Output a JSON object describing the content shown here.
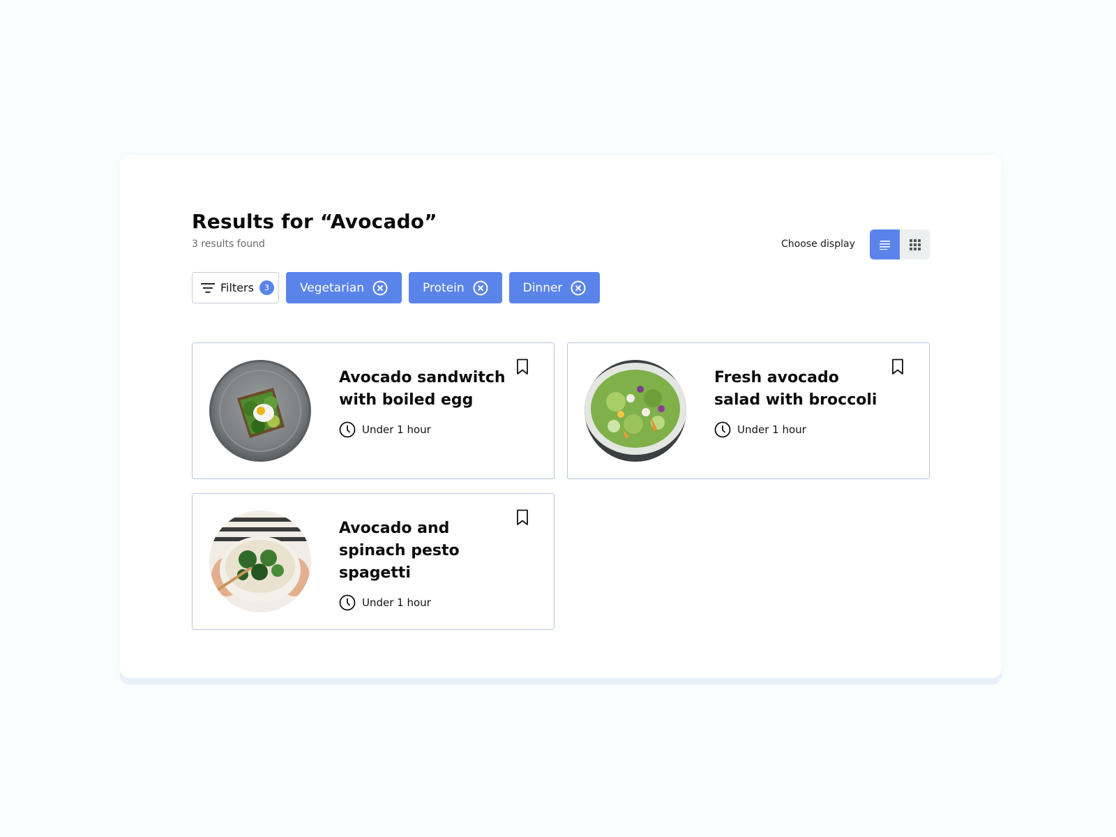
{
  "header": {
    "title": "Results for “Avocado”",
    "results_count": "3 results found"
  },
  "display": {
    "label": "Choose display",
    "options": [
      {
        "name": "list",
        "icon": "list-icon",
        "active": true
      },
      {
        "name": "grid",
        "icon": "grid-icon",
        "active": false
      }
    ]
  },
  "filters": {
    "label": "Filters",
    "count": "3",
    "chips": [
      "Vegetarian",
      "Protein",
      "Dinner"
    ]
  },
  "recipes": [
    {
      "title": "Avocado sandwitch with boiled egg",
      "time": "Under 1 hour",
      "image": "avocado-toast-egg-photo"
    },
    {
      "title": "Fresh avocado salad with broccoli",
      "time": "Under 1 hour",
      "image": "avocado-salad-photo"
    },
    {
      "title": "Avocado and spinach pesto spagetti",
      "time": "Under 1 hour",
      "image": "spinach-pesto-bowl-photo"
    }
  ],
  "colors": {
    "accent": "#5b84ea",
    "page_background": "#f8fefe",
    "card_border": "#b9c6dc"
  }
}
